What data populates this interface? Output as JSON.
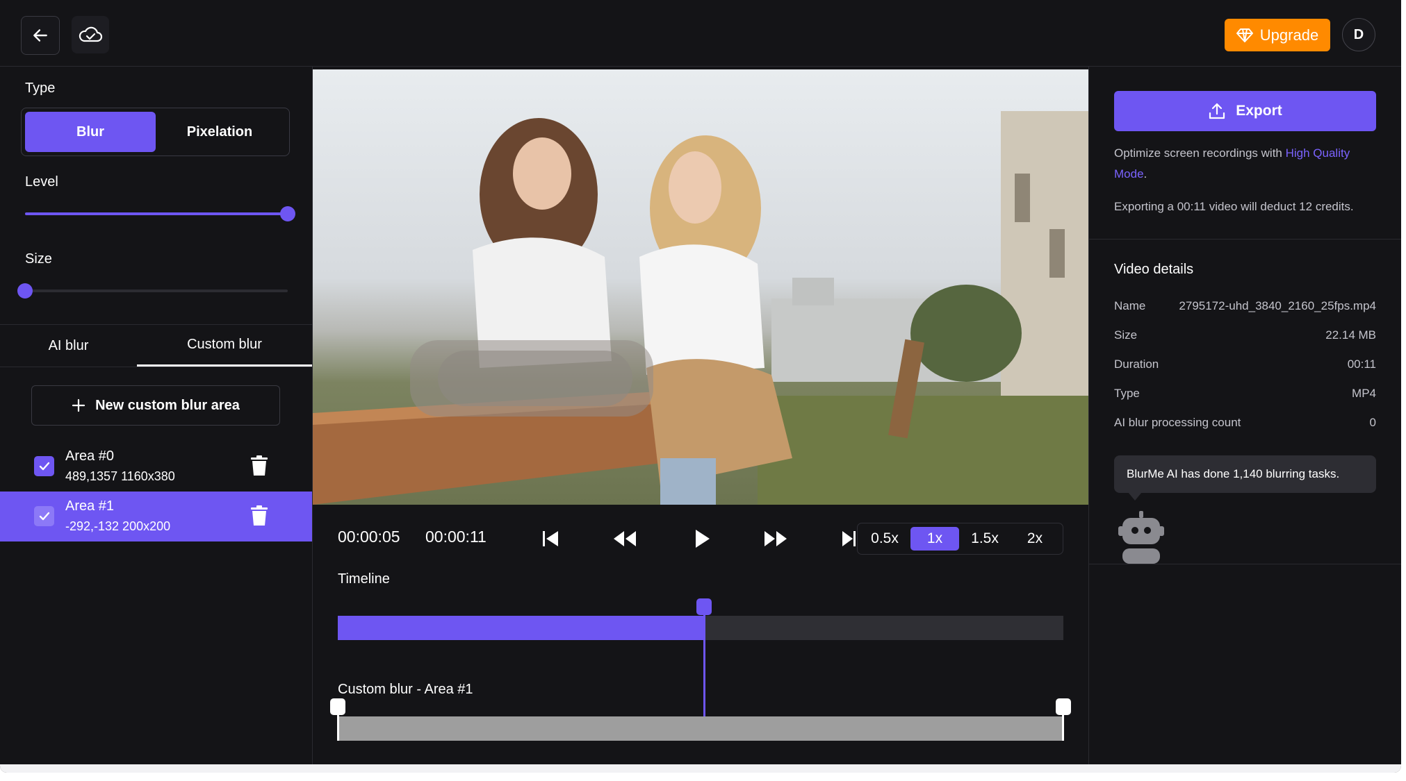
{
  "topbar": {
    "back_icon": "arrow-left-icon",
    "cloud_icon": "cloud-check-icon",
    "upgrade_label": "Upgrade",
    "upgrade_icon": "diamond-icon",
    "avatar_initial": "D"
  },
  "left_panel": {
    "type_label": "Type",
    "type_options": [
      "Blur",
      "Pixelation"
    ],
    "type_selected": "Blur",
    "level_label": "Level",
    "level_value": 1.0,
    "size_label": "Size",
    "size_value": 0.0,
    "tabs": [
      "AI blur",
      "Custom blur"
    ],
    "active_tab": "Custom blur",
    "new_area_label": "New custom blur area",
    "areas": [
      {
        "name": "Area #0",
        "dims": "489,1357 1160x380",
        "checked": true,
        "selected": false
      },
      {
        "name": "Area #1",
        "dims": "-292,-132 200x200",
        "checked": true,
        "selected": true
      }
    ]
  },
  "player": {
    "current_time": "00:00:05",
    "total_time": "00:00:11",
    "speeds": [
      "0.5x",
      "1x",
      "1.5x",
      "2x"
    ],
    "speed_selected": "1x",
    "timeline_label": "Timeline",
    "progress": 0.505,
    "custom_blur_track_label": "Custom blur - Area #1",
    "blur_range_start": 0.0,
    "blur_range_end": 1.0
  },
  "right_panel": {
    "export_label": "Export",
    "optimize_prefix": "Optimize screen recordings with ",
    "optimize_link": "High Quality Mode",
    "optimize_suffix": ".",
    "credits_note": "Exporting a 00:11 video will deduct 12 credits.",
    "details_title": "Video details",
    "details": [
      {
        "k": "Name",
        "v": "2795172-uhd_3840_2160_25fps.mp4"
      },
      {
        "k": "Size",
        "v": "22.14 MB"
      },
      {
        "k": "Duration",
        "v": "00:11"
      },
      {
        "k": "Type",
        "v": "MP4"
      },
      {
        "k": "AI blur processing count",
        "v": "0"
      }
    ],
    "bubble_text": "BlurMe AI has done 1,140 blurring tasks."
  },
  "colors": {
    "accent": "#6e56f2",
    "upgrade": "#ff8a00",
    "background": "#141417"
  }
}
